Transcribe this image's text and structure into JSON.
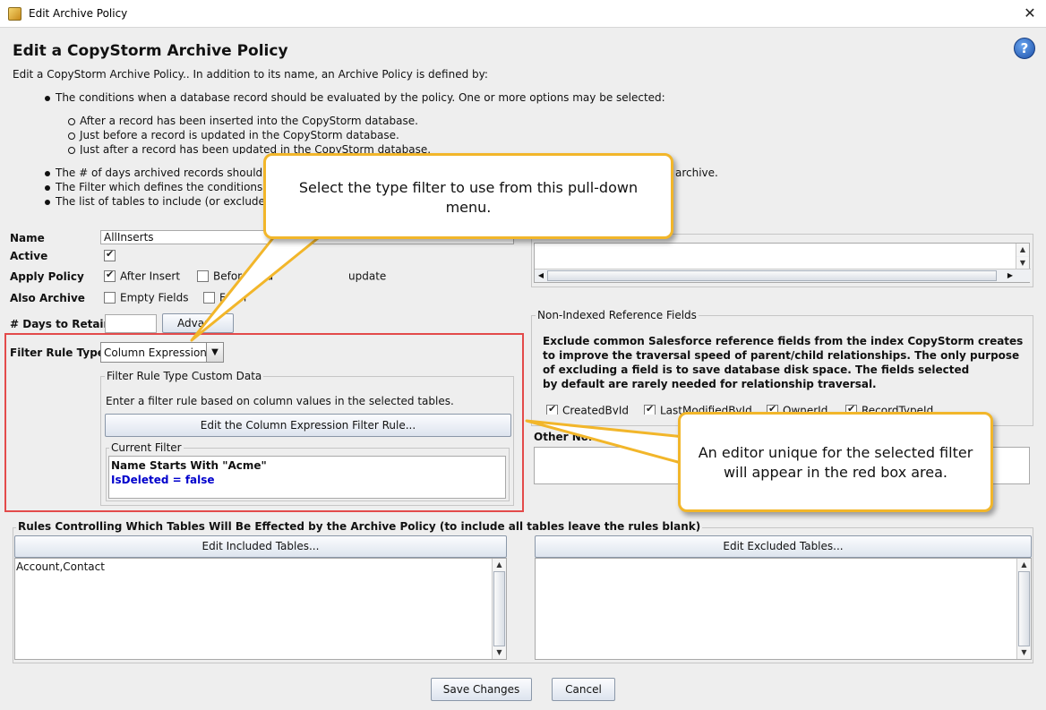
{
  "window": {
    "title": "Edit Archive Policy"
  },
  "header": {
    "title": "Edit a CopyStorm Archive Policy",
    "intro": "Edit a CopyStorm Archive Policy.. In addition to its name, an Archive Policy is defined by:"
  },
  "bullets": {
    "conditions": "The conditions when a database record should be evaluated by the policy. One or more options may be selected:",
    "options": [
      "After a record has been inserted into the CopyStorm database.",
      "Just before a record is updated in the CopyStorm database.",
      "Just after a record has been updated in the CopyStorm database."
    ],
    "days": "The # of days archived records should be r",
    "days_tail": "archive.",
    "filter": "The Filter which defines the conditions und",
    "tables": "The list of tables to include (or exclude) fro"
  },
  "form": {
    "name_label": "Name",
    "name_value": "AllInserts",
    "active_label": "Active",
    "apply_label": "Apply Policy",
    "apply_options": [
      "After Insert",
      "Before Upd",
      "update"
    ],
    "also_label": "Also Archive",
    "also_options": [
      "Empty Fields",
      "Form"
    ],
    "days_label": "# Days to Retain",
    "advanced_button": "Advan",
    "filter_type_label": "Filter Rule Type",
    "filter_type_value": "Column Expression"
  },
  "custom_data": {
    "title": "Filter Rule Type Custom Data",
    "description": "Enter a filter rule based on column values in the selected tables.",
    "edit_button": "Edit the Column Expression Filter Rule...",
    "current_filter_title": "Current Filter",
    "filter_lines": [
      "Name Starts With \"Acme\"",
      "IsDeleted = false"
    ]
  },
  "non_indexed": {
    "title": "Non-Indexed Reference Fields",
    "description": [
      "Exclude common Salesforce reference fields from the index CopyStorm creates",
      "to improve the traversal speed of parent/child relationships. The only purpose",
      "of excluding a field is to save database disk space. The fields selected",
      "by default are rarely needed for relationship traversal."
    ],
    "fields": [
      "CreatedById",
      "LastModifiedById",
      "OwnerId",
      "RecordTypeId"
    ],
    "other_label": "Other Non-In"
  },
  "tables": {
    "title": "Rules Controlling Which Tables Will Be Effected by the Archive Policy (to include all tables leave the rules blank)",
    "included_button": "Edit Included Tables...",
    "included_value": "Account,Contact",
    "excluded_button": "Edit Excluded Tables..."
  },
  "footer": {
    "save": "Save Changes",
    "cancel": "Cancel"
  },
  "callouts": {
    "top": "Select the type filter to use from this pull-down menu.",
    "right": "An editor unique for the selected filter will appear in the red box area."
  },
  "colors": {
    "callout_border": "#f2b62a",
    "highlight_box": "#e34a4a",
    "filter_blue": "#0000cc"
  }
}
